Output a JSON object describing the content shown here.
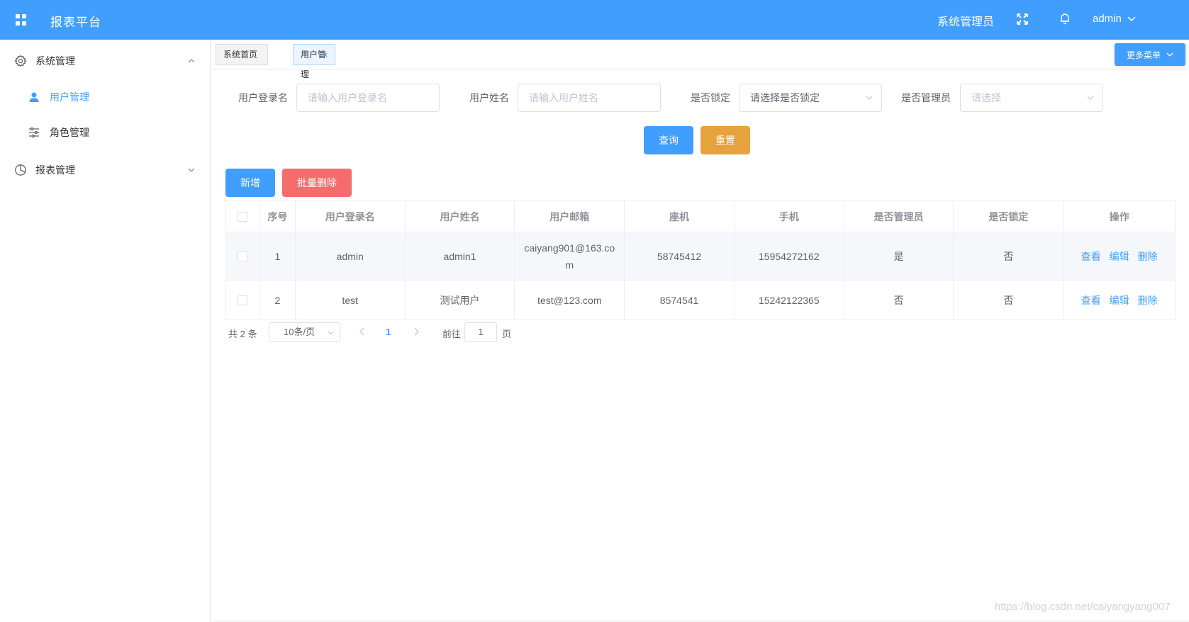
{
  "header": {
    "brand": "报表平台",
    "role": "系统管理员",
    "user": "admin",
    "bg_color": "#409EFF",
    "icons": [
      "grid-icon",
      "fullscreen-icon",
      "bell-icon",
      "chevron-down-icon"
    ]
  },
  "sidebar": {
    "groups": [
      {
        "label": "系统管理",
        "icon": "gear-icon",
        "expanded": true,
        "items": [
          {
            "label": "用户管理",
            "icon": "user-icon",
            "active": true
          },
          {
            "label": "角色管理",
            "icon": "sliders-icon",
            "active": false
          }
        ]
      },
      {
        "label": "报表管理",
        "icon": "pie-chart-icon",
        "expanded": false,
        "items": []
      }
    ]
  },
  "tabs": [
    {
      "label": "系统首页",
      "active": false
    },
    {
      "label": "用户管理",
      "active": true,
      "close": "×"
    }
  ],
  "more_menu": "更多菜单",
  "filters": {
    "login_name": {
      "label": "用户登录名",
      "placeholder": "请输入用户登录名"
    },
    "user_name": {
      "label": "用户姓名",
      "placeholder": "请输入用户姓名"
    },
    "locked": {
      "label": "是否锁定",
      "value": "请选择是否锁定"
    },
    "is_admin": {
      "label": "是否管理员",
      "placeholder": "请选择"
    }
  },
  "buttons": {
    "query": "查询",
    "reset": "重置",
    "add": "新增",
    "batch_delete": "批量删除"
  },
  "colors": {
    "primary": "#409EFF",
    "warning": "#E6A23C",
    "danger": "#F56C6C"
  },
  "table": {
    "columns": [
      "序号",
      "用户登录名",
      "用户姓名",
      "用户邮箱",
      "座机",
      "手机",
      "是否管理员",
      "是否锁定",
      "操作"
    ],
    "rows": [
      {
        "index": "1",
        "login": "admin",
        "name": "admin1",
        "email": "caiyang901@163.com",
        "phone": "58745412",
        "mobile": "15954272162",
        "admin": "是",
        "locked": "否"
      },
      {
        "index": "2",
        "login": "test",
        "name": "测试用户",
        "email": "test@123.com",
        "phone": "8574541",
        "mobile": "15242122365",
        "admin": "否",
        "locked": "否"
      }
    ],
    "actions": {
      "view": "查看",
      "edit": "编辑",
      "delete": "删除"
    }
  },
  "pagination": {
    "total": "共 2 条",
    "page_size": "10条/页",
    "current": "1",
    "goto_prefix": "前往",
    "goto_value": "1",
    "goto_suffix": "页"
  },
  "watermark": "https://blog.csdn.net/caiyangyang007"
}
